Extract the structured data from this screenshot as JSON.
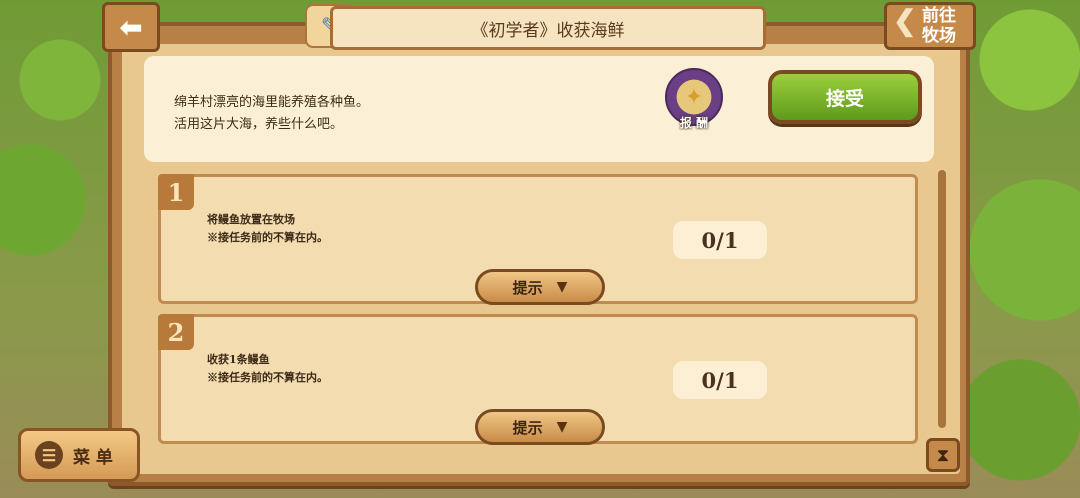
{
  "header": {
    "title": "《初学者》收获海鲜",
    "back_icon": "arrow-left-icon",
    "goto_line1": "前往",
    "goto_line2": "牧场"
  },
  "description": {
    "line1": "绵羊村漂亮的海里能养殖各种鱼。",
    "line2": "活用这片大海，养些什么吧。",
    "reward_label": "报 酬",
    "accept_label": "接受"
  },
  "tasks": [
    {
      "number": "1",
      "line1": "将鳗鱼放置在牧场",
      "line2": "※接任务前的不算在内。",
      "progress": "0/1",
      "hint_label": "提示"
    },
    {
      "number": "2",
      "line1": "收获1条鳗鱼",
      "line2": "※接任务前的不算在内。",
      "progress": "0/1",
      "hint_label": "提示"
    }
  ],
  "menu": {
    "label": "菜 单"
  },
  "colors": {
    "accept_green": "#7fb52c",
    "wood_brown": "#b78047",
    "parchment": "#f2dcb0"
  }
}
